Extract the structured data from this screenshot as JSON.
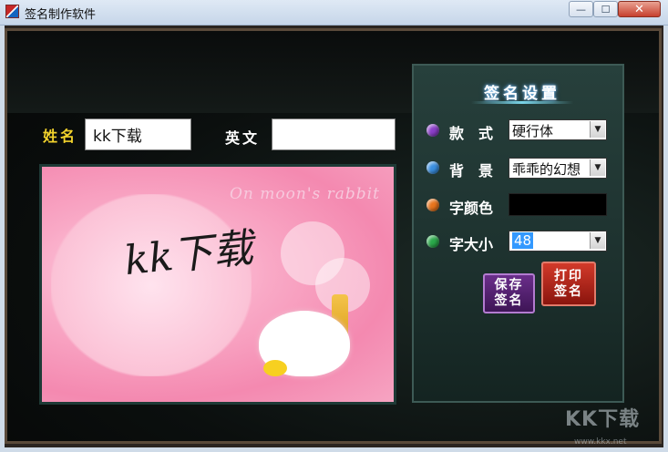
{
  "window": {
    "title": "签名制作软件",
    "close_label": "✕",
    "min_label": "—",
    "max_label": "☐"
  },
  "form": {
    "name_label": "姓名",
    "name_value": "kk下载",
    "english_label": "英文",
    "english_value": ""
  },
  "preview": {
    "heading_text": "On moon's rabbit",
    "signature_text": "kk下载"
  },
  "panel": {
    "title": "签名设置",
    "style_label": "款　式",
    "style_value": "硬行体",
    "background_label": "背　景",
    "background_value": "乖乖的幻想",
    "font_color_label": "字颜色",
    "font_color_value": "#000000",
    "font_size_label": "字大小",
    "font_size_value": "48",
    "save_button": "保存\n签名",
    "print_button": "打印\n签名"
  },
  "watermark": {
    "text": "KK下载",
    "url": "www.kkx.net"
  },
  "colors": {
    "name_label": "#f2d22c",
    "accent_dot_style": "#8a3ec8",
    "accent_dot_bg": "#3a8fe0",
    "accent_dot_color": "#e8741c",
    "accent_dot_size": "#2aa84a"
  }
}
